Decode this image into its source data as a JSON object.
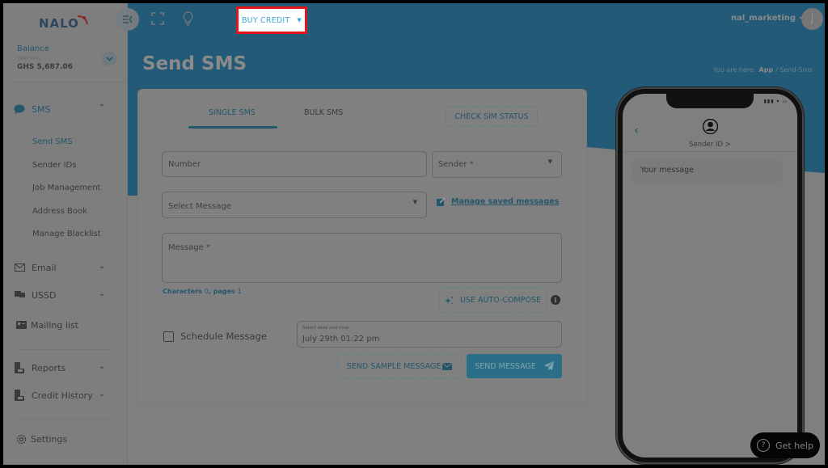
{
  "app": {
    "brand": "NALO"
  },
  "topbar": {
    "buy_credit_label": "BUY CREDIT",
    "username": "nal_marketing",
    "avatar_initial": "J"
  },
  "balance": {
    "label": "Balance",
    "sublabel": "SMS/EMAIL",
    "amount": "GHS 5,687.06"
  },
  "sidebar": {
    "sms": {
      "label": "SMS",
      "items": [
        {
          "label": "Send SMS",
          "active": true
        },
        {
          "label": "Sender IDs"
        },
        {
          "label": "Job Management"
        },
        {
          "label": "Address Book"
        },
        {
          "label": "Manage Blacklist"
        }
      ]
    },
    "email": "Email",
    "ussd": "USSD",
    "mailing_list": "Mailing list",
    "reports": "Reports",
    "credit_history": "Credit History",
    "settings": "Settings"
  },
  "page": {
    "title": "Send SMS",
    "breadcrumb": {
      "prefix": "You are here:",
      "app": "App",
      "current": "Send-Sms"
    }
  },
  "form": {
    "tabs": [
      {
        "label": "SINGLE SMS",
        "active": true
      },
      {
        "label": "BULK SMS"
      }
    ],
    "check_sim_label": "CHECK SIM STATUS",
    "number_placeholder": "Number",
    "sender_placeholder": "Sender *",
    "select_message_placeholder": "Select Message",
    "manage_saved_label": "Manage saved messages",
    "message_placeholder": "Message *",
    "characters_label": "Characters",
    "characters_count": "0",
    "pages_label": "pages",
    "pages_count": "1",
    "auto_compose_label": "USE AUTO-COMPOSE",
    "schedule_label": "Schedule Message",
    "schedule_checked": false,
    "date_label": "Select date and time",
    "date_value": "July 29th 01:22 pm",
    "send_sample_label": "SEND SAMPLE MESSAGE",
    "send_label": "SEND MESSAGE"
  },
  "preview": {
    "sender": "Sender ID >",
    "message": "Your message"
  },
  "help": {
    "label": "Get help"
  },
  "colors": {
    "brand_blue": "#24566c",
    "send_button": "#2a6f87",
    "highlight_border": "#e4141b",
    "highlight_text": "#3aa9cf"
  }
}
